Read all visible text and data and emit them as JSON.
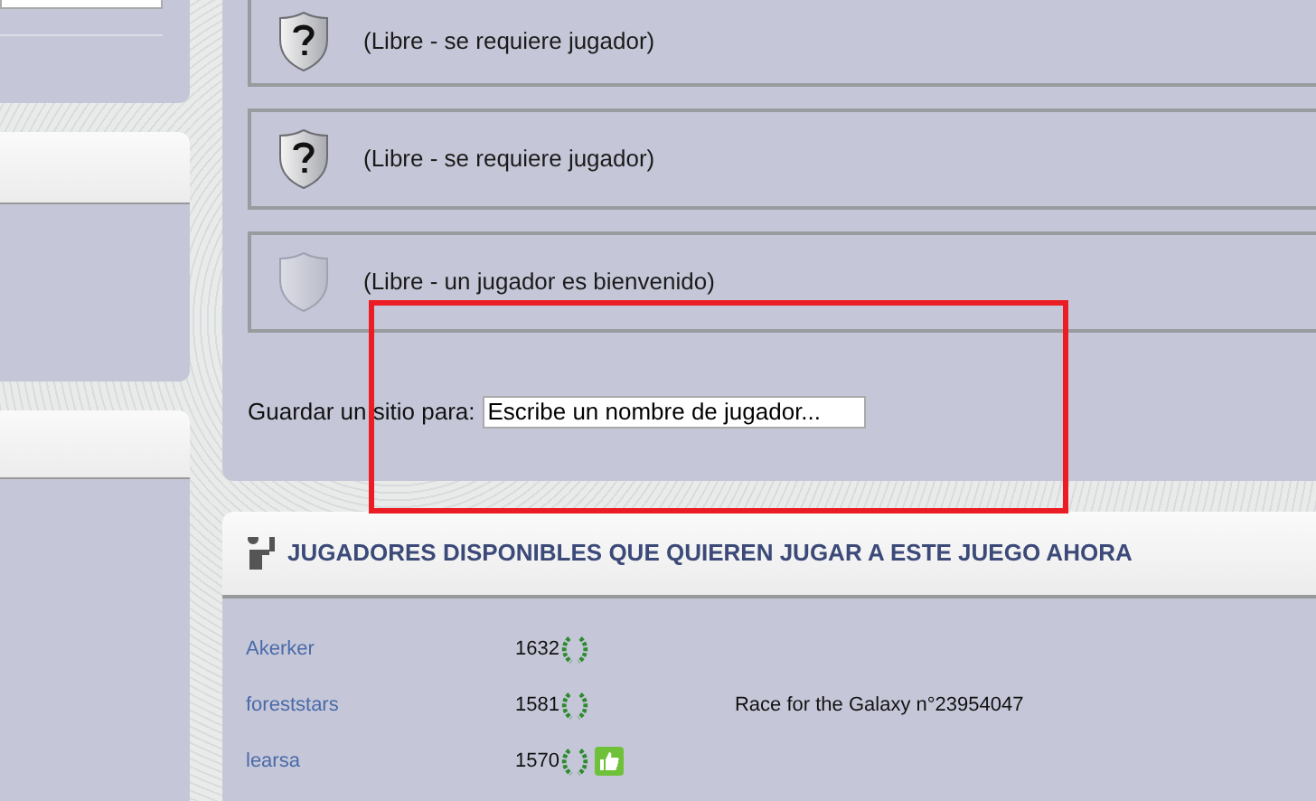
{
  "slots": [
    {
      "kind": "required",
      "text": "(Libre - se requiere jugador)"
    },
    {
      "kind": "required",
      "text": "(Libre - se requiere jugador)"
    },
    {
      "kind": "welcome",
      "text": "(Libre - un jugador es bienvenido)"
    }
  ],
  "reserve": {
    "label": "Guardar un sitio para:",
    "placeholder": "Escribe un nombre de jugador..."
  },
  "available": {
    "title": "JUGADORES DISPONIBLES QUE QUIEREN JUGAR A ESTE JUEGO AHORA",
    "players": [
      {
        "name": "Akerker",
        "elo": "1632",
        "thumbs_up": false
      },
      {
        "name": "foreststars",
        "elo": "1581",
        "thumbs_up": false,
        "game": "Race for the Galaxy n°23954047"
      },
      {
        "name": "learsa",
        "elo": "1570",
        "thumbs_up": true
      }
    ]
  }
}
